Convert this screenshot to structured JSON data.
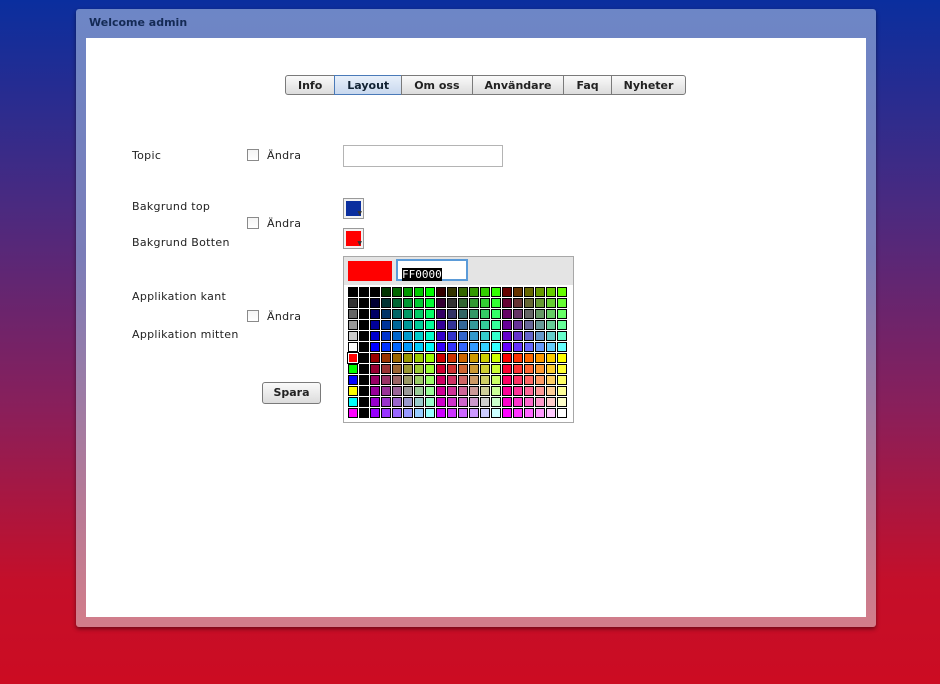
{
  "window": {
    "title": "Welcome admin"
  },
  "tabs": [
    {
      "label": "Info",
      "active": false
    },
    {
      "label": "Layout",
      "active": true
    },
    {
      "label": "Om oss",
      "active": false
    },
    {
      "label": "Användare",
      "active": false
    },
    {
      "label": "Faq",
      "active": false
    },
    {
      "label": "Nyheter",
      "active": false
    }
  ],
  "form": {
    "topic_label": "Topic",
    "andra_label": "Ändra",
    "topic_value": "",
    "bg_top_label": "Bakgrund top",
    "bg_bottom_label": "Bakgrund Botten",
    "app_kant_label": "Applikation kant",
    "app_mitten_label": "Applikation mitten",
    "save_label": "Spara",
    "bg_top_color": "#0a2e9e",
    "bg_bottom_color": "#ff0000"
  },
  "color_picker": {
    "hex_value": "FF0000",
    "preview_color": "#ff0000"
  }
}
